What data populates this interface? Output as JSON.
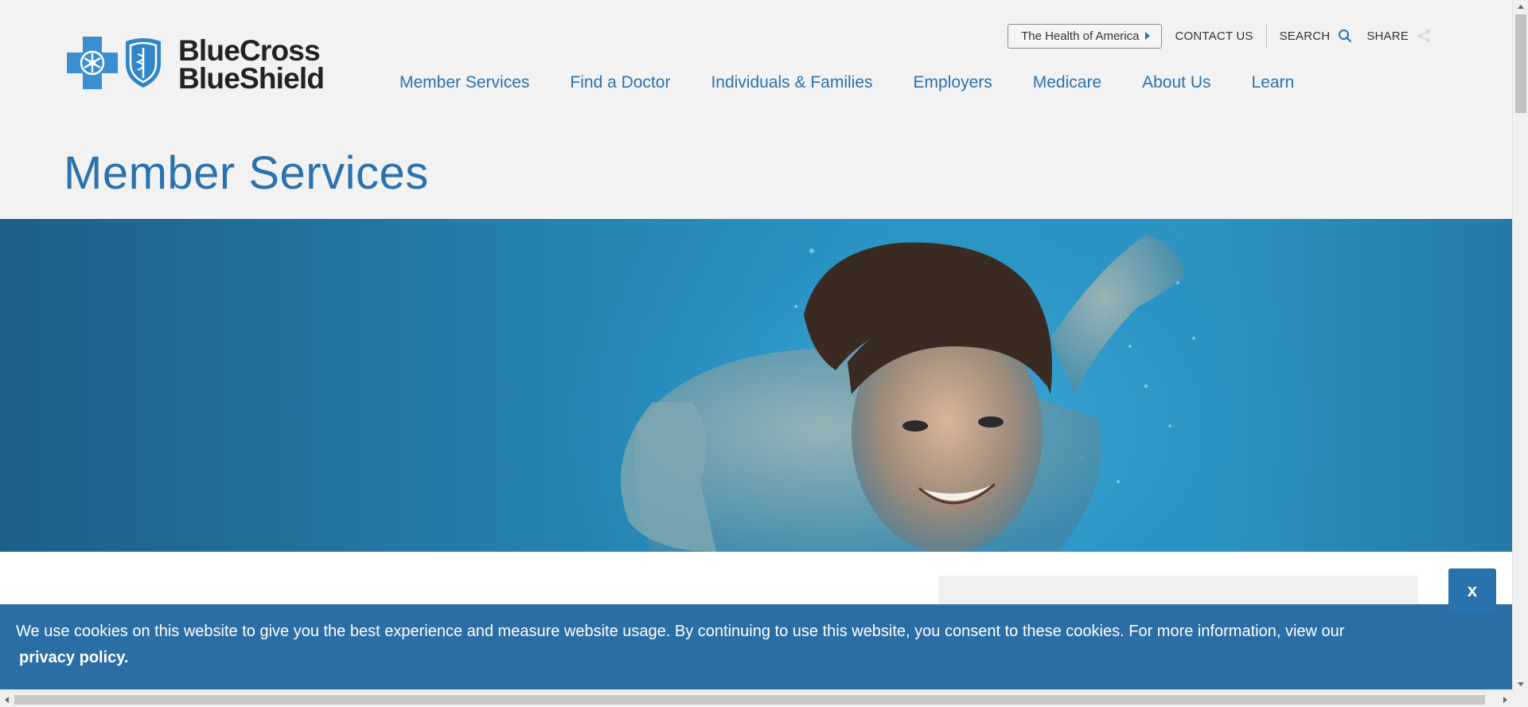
{
  "brand": {
    "line1": "BlueCross",
    "line2": "BlueShield",
    "color": "#2a72ad"
  },
  "utility_bar": {
    "health_of_america": "The Health of America",
    "contact": "CONTACT US",
    "search": "SEARCH",
    "share": "SHARE",
    "icons": [
      "caret-right-icon",
      "search-icon",
      "share-icon"
    ]
  },
  "nav": {
    "items": [
      {
        "label": "Member Services"
      },
      {
        "label": "Find a Doctor"
      },
      {
        "label": "Individuals & Families"
      },
      {
        "label": "Employers"
      },
      {
        "label": "Medicare"
      },
      {
        "label": "About Us"
      },
      {
        "label": "Learn"
      }
    ]
  },
  "page": {
    "title": "Member Services"
  },
  "close_button": {
    "label": "x"
  },
  "cookie_banner": {
    "text": "We use cookies on this website to give you the best experience and measure website usage. By continuing to use this website, you consent to these cookies. For more information, view our",
    "link": "privacy policy.",
    "background": "#2a6ea5"
  }
}
